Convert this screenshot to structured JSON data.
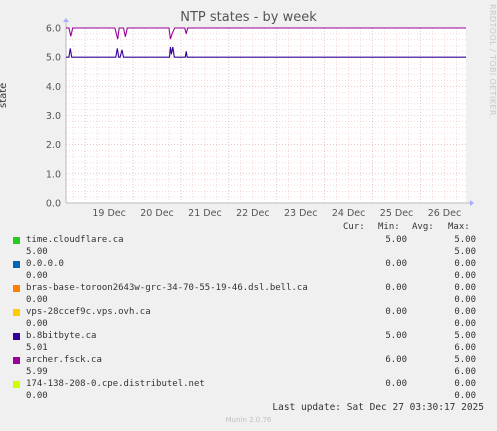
{
  "header": {
    "title": "NTP states - by week",
    "side_text": "RRDTOOL / TOBI OETIKER"
  },
  "colors": {
    "grid_minor": "#f0c0c0",
    "grid_major": "#e0a0a0",
    "axis": "#bbbbbb"
  },
  "chart_data": {
    "type": "line",
    "title": "NTP states - by week",
    "ylabel": "state",
    "ylim": [
      0,
      6
    ],
    "yticks": [
      "0.0",
      "1.0",
      "2.0",
      "3.0",
      "4.0",
      "5.0",
      "6.0"
    ],
    "xlim_days": [
      18.6,
      26.95
    ],
    "xticks": [
      "19 Dec",
      "20 Dec",
      "21 Dec",
      "22 Dec",
      "23 Dec",
      "24 Dec",
      "25 Dec",
      "26 Dec"
    ],
    "grid": true,
    "series": [
      {
        "name": "archer.fsck.ca",
        "color": "#990099",
        "x": [
          18.6,
          18.66,
          18.7,
          18.74,
          19.62,
          19.68,
          19.71,
          19.8,
          19.84,
          19.88,
          20.75,
          20.78,
          20.82,
          20.87,
          21.08,
          21.11,
          21.14,
          26.95
        ],
        "y": [
          6.0,
          6.0,
          5.72,
          6.0,
          6.0,
          5.62,
          6.0,
          6.0,
          5.7,
          6.0,
          6.0,
          5.62,
          5.82,
          6.0,
          6.0,
          5.8,
          6.0,
          6.0
        ]
      },
      {
        "name": "b.8bitbyte.ca",
        "color": "#330099",
        "x": [
          18.6,
          18.66,
          18.69,
          18.72,
          19.64,
          19.67,
          19.7,
          19.73,
          19.77,
          19.8,
          19.83,
          20.76,
          20.78,
          20.8,
          20.83,
          20.86,
          21.09,
          21.11,
          21.13,
          26.95
        ],
        "y": [
          5.0,
          5.0,
          5.3,
          5.0,
          5.0,
          5.3,
          5.0,
          5.0,
          5.25,
          5.0,
          5.0,
          5.0,
          5.35,
          5.1,
          5.35,
          5.0,
          5.0,
          5.2,
          5.0,
          5.0
        ]
      }
    ]
  },
  "legend": {
    "headers": {
      "cur": "Cur:",
      "min": "Min:",
      "avg": "Avg:",
      "max": "Max:"
    },
    "rows": [
      {
        "name": "time.cloudflare.ca",
        "color": "#22cc22",
        "cur": "5.00",
        "min": "",
        "avg": "",
        "max": "5.00",
        "cur2": "5.00",
        "max2": "5.00"
      },
      {
        "name": "0.0.0.0",
        "color": "#0066b3",
        "cur": "",
        "min": "0.00",
        "avg": "",
        "max": "0.00",
        "cur2": "0.00",
        "max2": "0.00"
      },
      {
        "name": "bras-base-toroon2643w-grc-34-70-55-19-46.dsl.bell.ca",
        "color": "#ff8000",
        "cur": "",
        "min": "0.00",
        "avg": "",
        "max": "0.00",
        "cur2": "0.00",
        "max2": "0.00"
      },
      {
        "name": "vps-28ccef9c.vps.ovh.ca",
        "color": "#ffcc00",
        "cur": "",
        "min": "0.00",
        "avg": "",
        "max": "0.00",
        "cur2": "0.00",
        "max2": "0.00"
      },
      {
        "name": "b.8bitbyte.ca",
        "color": "#330099",
        "cur": "5.00",
        "min": "",
        "avg": "",
        "max": "5.00",
        "cur2": "5.01",
        "max2": "6.00"
      },
      {
        "name": "archer.fsck.ca",
        "color": "#990099",
        "cur": "6.00",
        "min": "",
        "avg": "",
        "max": "5.00",
        "cur2": "5.99",
        "max2": "6.00"
      },
      {
        "name": "174-138-208-0.cpe.distributel.net",
        "color": "#ccff00",
        "cur": "",
        "min": "0.00",
        "avg": "",
        "max": "0.00",
        "cur2": "0.00",
        "max2": "0.00"
      }
    ]
  },
  "footer": {
    "last_update": "Last update: Sat Dec 27 03:30:17 2025",
    "munin": "Munin 2.0.76"
  }
}
